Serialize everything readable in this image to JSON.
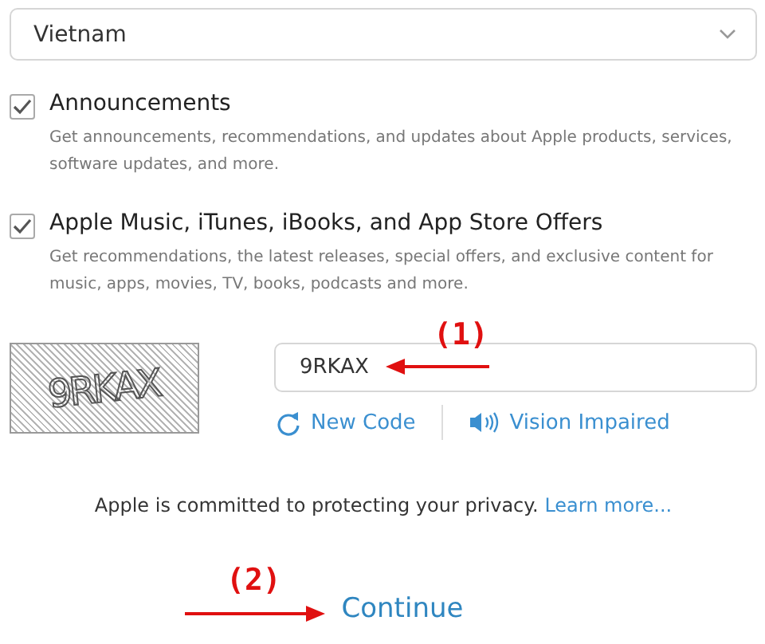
{
  "country_select": {
    "value": "Vietnam"
  },
  "subscriptions": [
    {
      "label": "Announcements",
      "description": "Get announcements, recommendations, and updates about Apple products, services, software updates, and more.",
      "checked": true
    },
    {
      "label": "Apple Music, iTunes, iBooks, and App Store Offers",
      "description": "Get recommendations, the latest releases, special offers, and exclusive content for music, apps, movies, TV, books, podcasts and more.",
      "checked": true
    }
  ],
  "captcha": {
    "image_text": "9RKAX",
    "value": "9RKAX",
    "new_code": "New Code",
    "vision_impaired": "Vision Impaired"
  },
  "privacy": {
    "text": "Apple is committed to protecting your privacy.",
    "link": "Learn more..."
  },
  "continue": "Continue",
  "annotations": [
    {
      "label": "(1)",
      "kind": "left"
    },
    {
      "label": "(2)",
      "kind": "right"
    }
  ]
}
